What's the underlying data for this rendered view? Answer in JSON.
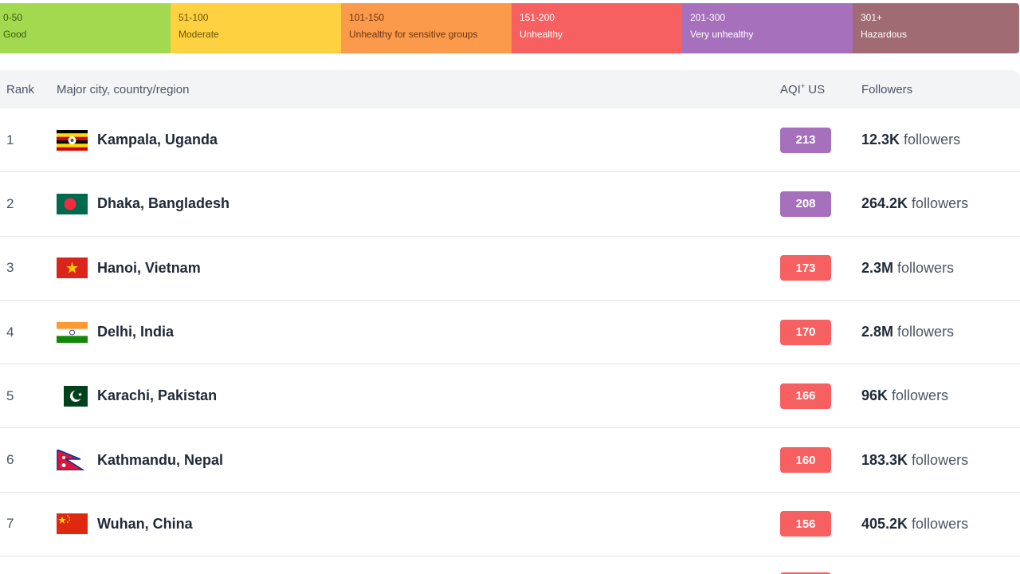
{
  "legend": [
    {
      "range": "0-50",
      "label": "Good",
      "color": "#a3d94f",
      "text_color": "#3d5a10"
    },
    {
      "range": "51-100",
      "label": "Moderate",
      "color": "#fdd13f",
      "text_color": "#6b5208"
    },
    {
      "range": "101-150",
      "label": "Unhealthy for sensitive groups",
      "color": "#fb9a4b",
      "text_color": "#6a3410"
    },
    {
      "range": "151-200",
      "label": "Unhealthy",
      "color": "#f76060",
      "text_color": "#ffffff"
    },
    {
      "range": "201-300",
      "label": "Very unhealthy",
      "color": "#a670bd",
      "text_color": "#ffffff"
    },
    {
      "range": "301+",
      "label": "Hazardous",
      "color": "#a06b73",
      "text_color": "#ffffff"
    }
  ],
  "table": {
    "headers": {
      "rank": "Rank",
      "city": "Major city, country/region",
      "aqi": "AQI",
      "aqi_sup": "+",
      "aqi_suffix": " US",
      "followers": "Followers"
    },
    "followers_suffix": " followers",
    "rows": [
      {
        "rank": "1",
        "city": "Kampala, Uganda",
        "flag": "uganda-flag-icon",
        "aqi": "213",
        "aqi_color": "#a670bd",
        "followers": "12.3K"
      },
      {
        "rank": "2",
        "city": "Dhaka, Bangladesh",
        "flag": "bangladesh-flag-icon",
        "aqi": "208",
        "aqi_color": "#a670bd",
        "followers": "264.2K"
      },
      {
        "rank": "3",
        "city": "Hanoi, Vietnam",
        "flag": "vietnam-flag-icon",
        "aqi": "173",
        "aqi_color": "#f76060",
        "followers": "2.3M"
      },
      {
        "rank": "4",
        "city": "Delhi, India",
        "flag": "india-flag-icon",
        "aqi": "170",
        "aqi_color": "#f76060",
        "followers": "2.8M"
      },
      {
        "rank": "5",
        "city": "Karachi, Pakistan",
        "flag": "pakistan-flag-icon",
        "aqi": "166",
        "aqi_color": "#f76060",
        "followers": "96K"
      },
      {
        "rank": "6",
        "city": "Kathmandu, Nepal",
        "flag": "nepal-flag-icon",
        "aqi": "160",
        "aqi_color": "#f76060",
        "followers": "183.3K"
      },
      {
        "rank": "7",
        "city": "Wuhan, China",
        "flag": "china-flag-icon",
        "aqi": "156",
        "aqi_color": "#f76060",
        "followers": "405.2K"
      }
    ]
  }
}
